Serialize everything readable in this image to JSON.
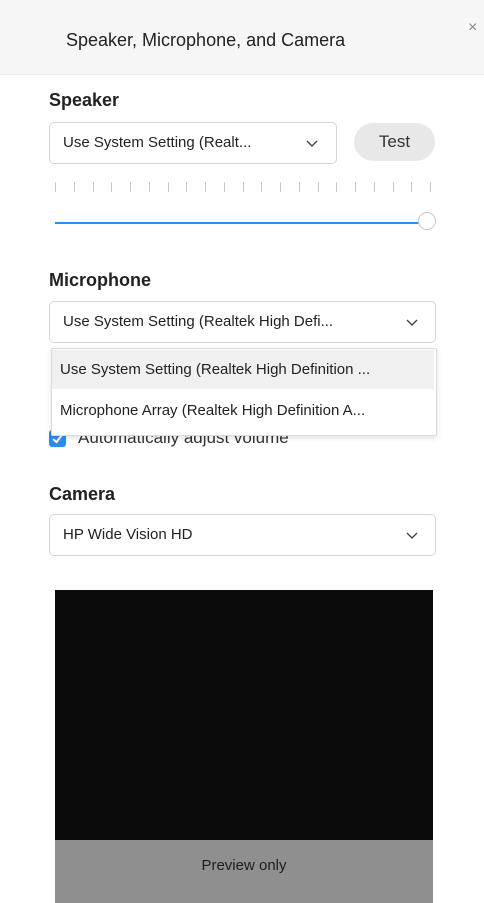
{
  "dialog": {
    "title": "Speaker, Microphone, and Camera",
    "close_glyph": "×"
  },
  "speaker": {
    "label": "Speaker",
    "selected": "Use System Setting (Realt...",
    "test_label": "Test",
    "volume_level": 1.0
  },
  "microphone": {
    "label": "Microphone",
    "selected": "Use System Setting (Realtek High Defi...",
    "options": [
      "Use System Setting (Realtek High Definition ...",
      "Microphone Array (Realtek High Definition A..."
    ],
    "auto_adjust_label": "Automatically adjust volume",
    "auto_adjust_checked": true
  },
  "camera": {
    "label": "Camera",
    "selected": "HP Wide Vision HD",
    "preview_label": "Preview only"
  },
  "colors": {
    "accent": "#2d8cf0",
    "preview_bg": "#0b0b0c",
    "preview_bar": "#8f8f8f"
  },
  "icons": {
    "close": "close-icon",
    "dropdown": "chevron-down-icon",
    "check": "checkmark-icon"
  }
}
